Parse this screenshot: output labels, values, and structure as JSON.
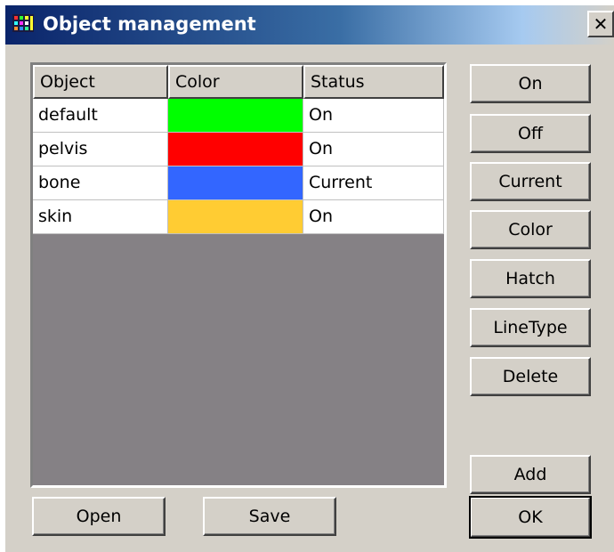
{
  "window": {
    "title": "Object management",
    "close_glyph": "✕"
  },
  "table": {
    "columns": [
      "Object",
      "Color",
      "Status"
    ],
    "rows": [
      {
        "object": "default",
        "color": "#00ff00",
        "status": "On"
      },
      {
        "object": "pelvis",
        "color": "#ff0000",
        "status": "On"
      },
      {
        "object": "bone",
        "color": "#3366ff",
        "status": "Current"
      },
      {
        "object": "skin",
        "color": "#ffcc33",
        "status": "On"
      }
    ]
  },
  "side_buttons": {
    "on": "On",
    "off": "Off",
    "current": "Current",
    "color": "Color",
    "hatch": "Hatch",
    "linetype": "LineType",
    "delete": "Delete",
    "add": "Add",
    "ok": "OK"
  },
  "bottom_buttons": {
    "open": "Open",
    "save": "Save"
  }
}
